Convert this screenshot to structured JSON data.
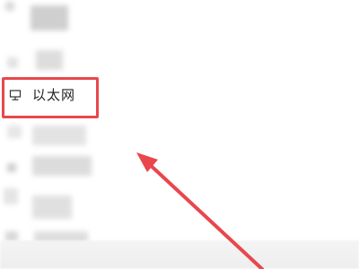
{
  "sidebar": {
    "items": [
      {
        "label": "以太网",
        "icon": "ethernet-icon",
        "highlighted": true
      }
    ]
  },
  "annotation": {
    "color": "#e8474d"
  }
}
